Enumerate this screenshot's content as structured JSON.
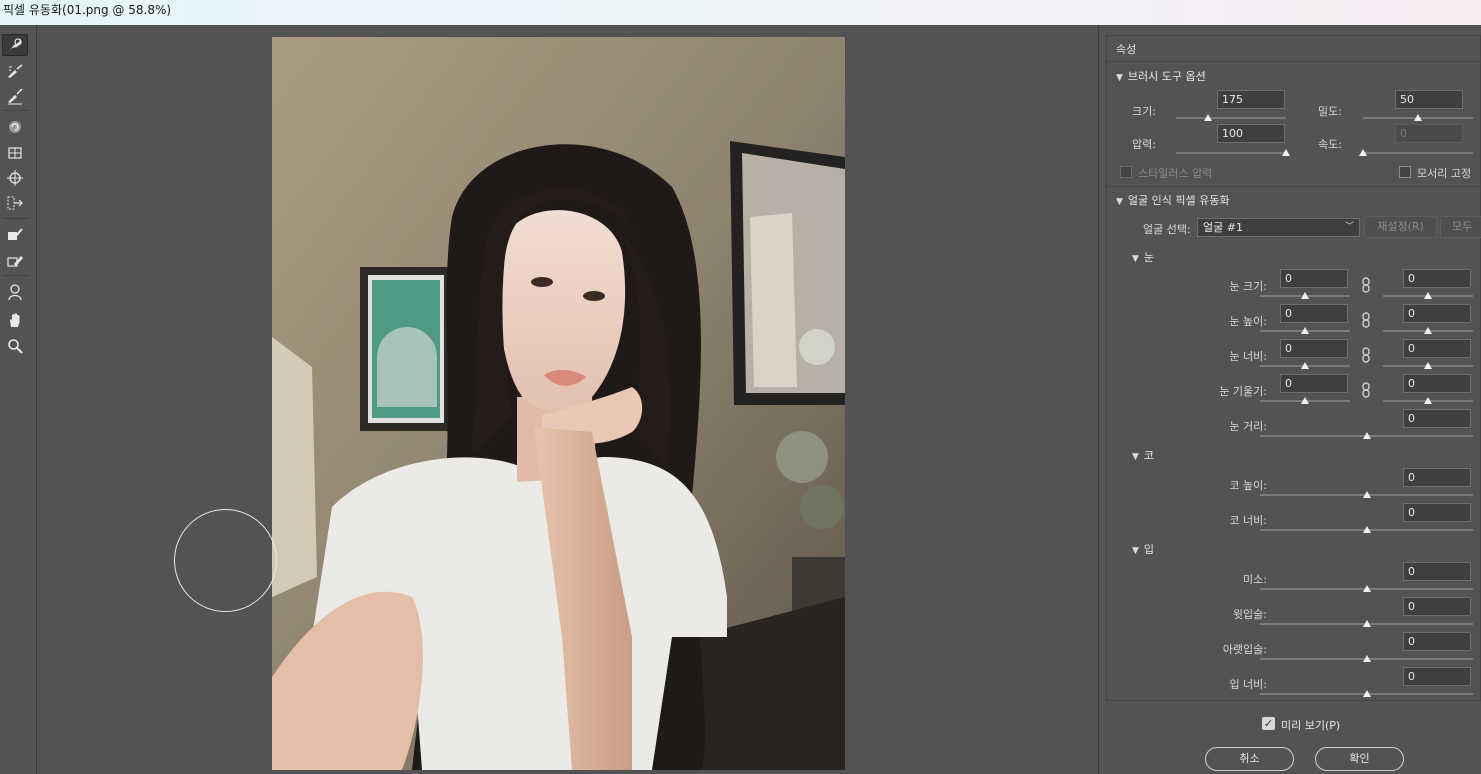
{
  "window": {
    "title": "픽셀 유동화(01.png @ 58.8%)"
  },
  "tools": [
    {
      "name": "forward-warp-tool-icon"
    },
    {
      "name": "reconstruct-tool-icon"
    },
    {
      "name": "smooth-tool-icon"
    },
    {
      "name": "twirl-tool-icon"
    },
    {
      "name": "pucker-tool-icon"
    },
    {
      "name": "bloat-tool-icon"
    },
    {
      "name": "push-left-tool-icon"
    },
    {
      "name": "freeze-mask-tool-icon"
    },
    {
      "name": "thaw-mask-tool-icon"
    },
    {
      "name": "face-tool-icon"
    },
    {
      "name": "hand-tool-icon"
    },
    {
      "name": "zoom-tool-icon"
    }
  ],
  "panel": {
    "title": "속성",
    "brush": {
      "heading": "브러시 도구 옵션",
      "size_label": "크기:",
      "size_value": "175",
      "size_pct": 0.29,
      "density_label": "밀도:",
      "density_value": "50",
      "density_pct": 0.5,
      "pressure_label": "압력:",
      "pressure_value": "100",
      "pressure_pct": 1.0,
      "rate_label": "속도:",
      "rate_value": "0",
      "rate_pct": 0.0,
      "stylus_label": "스타일러스 압력",
      "pin_edges_label": "모서리 고정"
    },
    "face": {
      "heading": "얼굴 인식 픽셀 유동화",
      "select_label": "얼굴 선택:",
      "select_value": "얼굴 #1",
      "reset_label": "재설정(R)",
      "all_label": "모두",
      "eyes": {
        "heading": "눈",
        "eye_size": "눈 크기:",
        "eye_height": "눈 높이:",
        "eye_width": "눈 너비:",
        "eye_tilt": "눈 기울기:",
        "eye_distance": "눈 거리:",
        "value": "0"
      },
      "nose": {
        "heading": "코",
        "nose_height": "코 높이:",
        "nose_width": "코 너비:",
        "value": "0"
      },
      "mouth": {
        "heading": "입",
        "smile": "미소:",
        "upper_lip": "윗입술:",
        "lower_lip": "아랫입술:",
        "mouth_width": "입 너비:",
        "value": "0"
      }
    }
  },
  "footer": {
    "preview_label": "미리 보기(P)",
    "cancel_label": "취소",
    "ok_label": "확인"
  },
  "colors": {
    "background": "#535353",
    "field": "#3f3f3f",
    "titlebar_left": "#e3f5f9",
    "titlebar_right": "#f6ecf2"
  }
}
